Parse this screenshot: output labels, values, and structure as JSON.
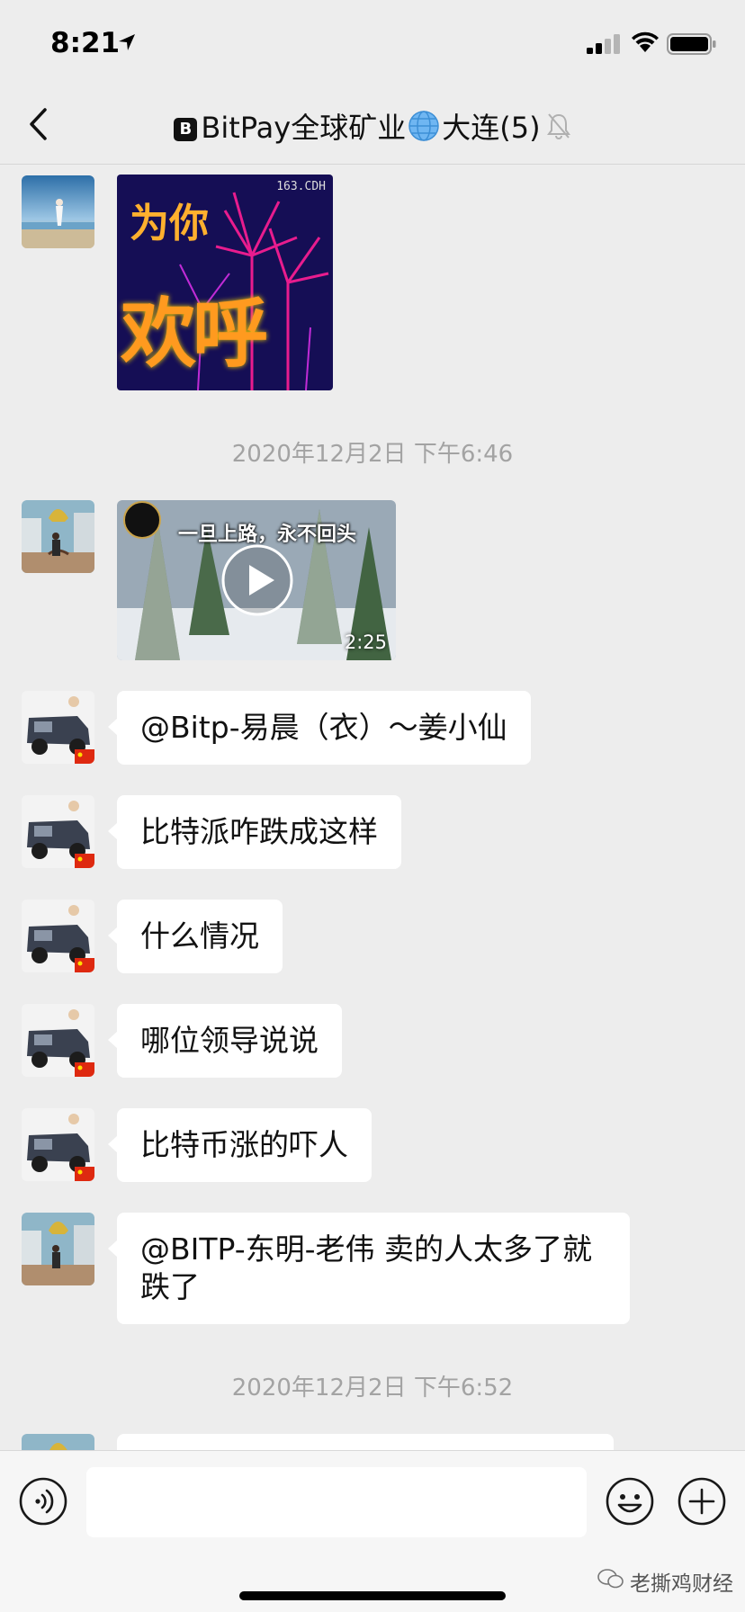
{
  "status_bar": {
    "time": "8:21"
  },
  "nav": {
    "title_badge": "B",
    "title_part1": "BitPay全球矿业",
    "title_part2": "大连(5)"
  },
  "messages": [
    {
      "type": "sticker",
      "sender": "member-beach",
      "line1": "为你",
      "line2": "欢呼",
      "tag": "163.CDH"
    },
    {
      "type": "timestamp",
      "text": "2020年12月2日 下午6:46"
    },
    {
      "type": "video",
      "sender": "member-city",
      "caption": "一旦上路，永不回头",
      "duration": "2:25"
    },
    {
      "type": "text",
      "sender": "member-car",
      "text": "@Bitp-易晨（衣）～姜小仙"
    },
    {
      "type": "text",
      "sender": "member-car",
      "text": "比特派咋跌成这样"
    },
    {
      "type": "text",
      "sender": "member-car",
      "text": "什么情况"
    },
    {
      "type": "text",
      "sender": "member-car",
      "text": "哪位领导说说"
    },
    {
      "type": "text",
      "sender": "member-car",
      "text": "比特币涨的吓人"
    },
    {
      "type": "text",
      "sender": "member-city",
      "text": "@BITP-东明-老伟 卖的人太多了就跌了"
    },
    {
      "type": "timestamp",
      "text": "2020年12月2日 下午6:52"
    }
  ],
  "input_bar": {
    "value": "",
    "placeholder": ""
  },
  "watermark": "老撕鸡财经",
  "colors": {
    "background": "#EDEDED",
    "bubble": "#FFFFFF",
    "timestamp": "#A3A3A3"
  }
}
